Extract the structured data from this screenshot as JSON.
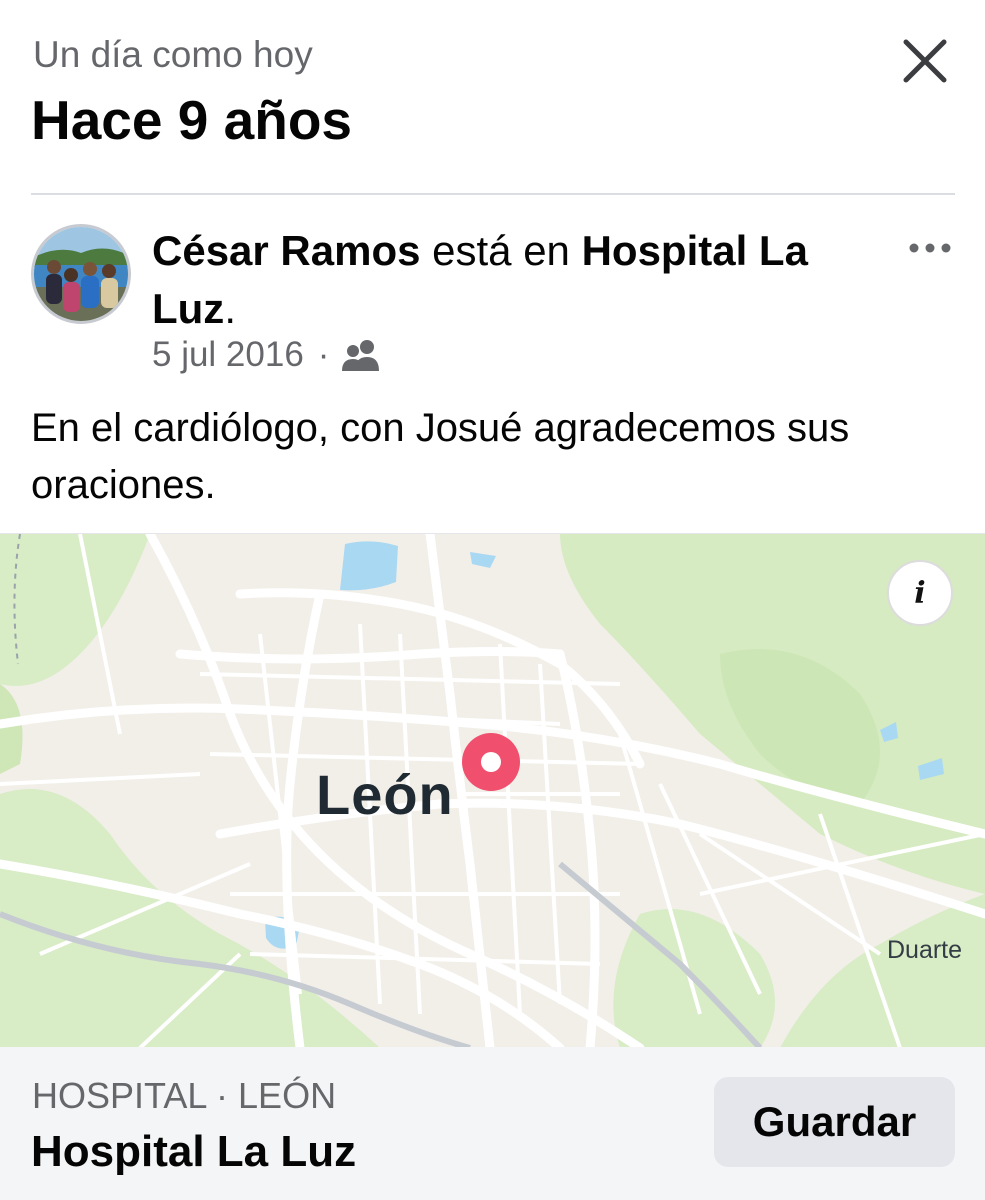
{
  "memory": {
    "subtitle": "Un día como hoy",
    "title": "Hace 9 años"
  },
  "post": {
    "author": "César Ramos",
    "connector": " está en ",
    "place": "Hospital La Luz",
    "end": ".",
    "date": "5 jul 2016",
    "separator": "·",
    "audience_icon": "friends-icon",
    "text": "En el cardiólogo, con Josué agradecemos sus oraciones."
  },
  "map": {
    "city_label": "León",
    "town_label": "Duarte",
    "info_label": "i",
    "pin_color": "#f0506e"
  },
  "place_card": {
    "category": "HOSPITAL · LEÓN",
    "name": "Hospital La Luz",
    "save_label": "Guardar"
  },
  "colors": {
    "secondary_text": "#65676b",
    "divider": "#dadde1",
    "button_bg": "#e4e6eb",
    "footer_bg": "#f4f5f6"
  }
}
